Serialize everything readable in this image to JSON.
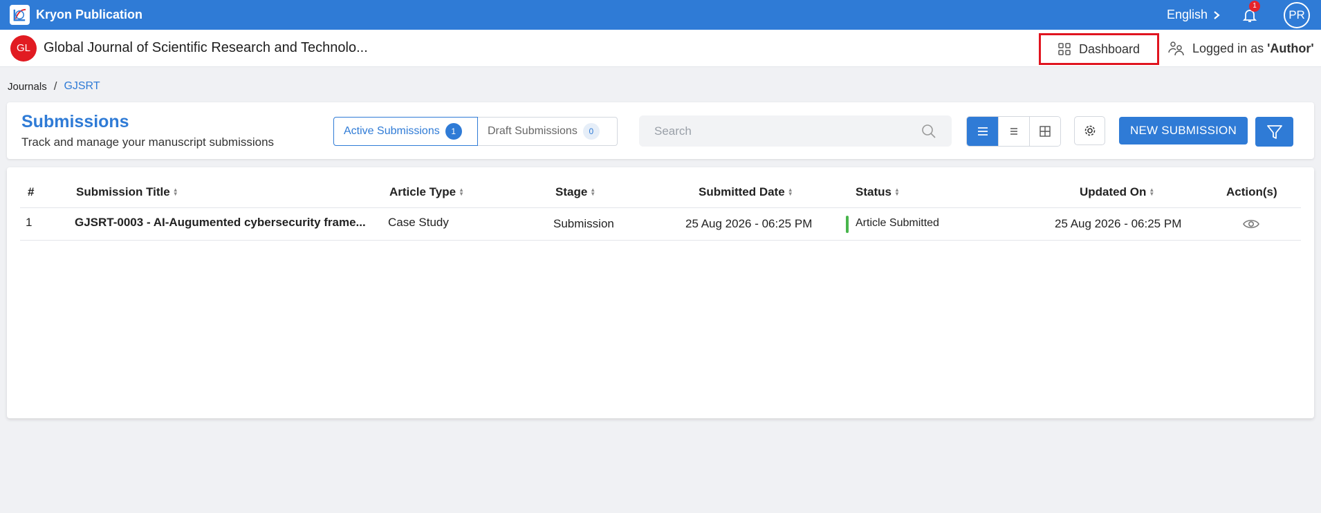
{
  "app": {
    "name": "Kryon Publication"
  },
  "topbar": {
    "language": "English",
    "notification_count": "1",
    "user_initials": "PR"
  },
  "journal": {
    "initials": "GL",
    "title": "Global Journal of Scientific Research and Technolo..."
  },
  "header_actions": {
    "dashboard_label": "Dashboard",
    "logged_in_prefix": "Logged in as ",
    "logged_in_role": "'Author'"
  },
  "breadcrumb": {
    "root": "Journals",
    "separator": "/",
    "current": "GJSRT"
  },
  "submissions": {
    "title": "Submissions",
    "subtitle": "Track and manage your manuscript submissions",
    "tabs": [
      {
        "label": "Active Submissions",
        "count": "1"
      },
      {
        "label": "Draft Submissions",
        "count": "0"
      }
    ],
    "search_placeholder": "Search",
    "new_button": "NEW SUBMISSION"
  },
  "table": {
    "columns": [
      "#",
      "Submission Title",
      "Article Type",
      "Stage",
      "Submitted Date",
      "Status",
      "Updated On",
      "Action(s)"
    ],
    "rows": [
      {
        "num": "1",
        "title": "GJSRT-0003 - AI-Augumented cybersecurity frame...",
        "article_type": "Case Study",
        "stage": "Submission",
        "submitted": "25 Aug 2026 - 06:25 PM",
        "status": "Article Submitted",
        "updated": "25 Aug 2026 - 06:25 PM"
      }
    ]
  },
  "colors": {
    "primary": "#2f7bd6",
    "highlight": "#e0141f",
    "status_green": "#48b54c",
    "journal_avatar": "#e11b22"
  }
}
